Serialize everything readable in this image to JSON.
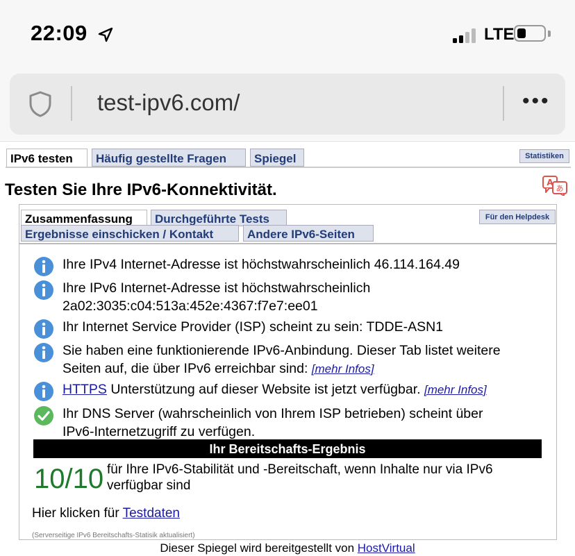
{
  "status_bar": {
    "time": "22:09",
    "network": "LTE"
  },
  "url_bar": {
    "url": "test-ipv6.com/",
    "menu": "•••"
  },
  "top_tabs": {
    "test": "IPv6 testen",
    "faq": "Häufig gestellte Fragen",
    "mirror": "Spiegel",
    "stats": "Statistiken"
  },
  "page_title": "Testen Sie Ihre IPv6-Konnektivität.",
  "inner_tabs": {
    "summary": "Zusammenfassung",
    "tests": "Durchgeführte Tests",
    "helpdesk": "Für den Helpdesk",
    "submit": "Ergebnisse einschicken / Kontakt",
    "other": "Andere IPv6-Seiten"
  },
  "results": {
    "ipv4": "Ihre IPv4 Internet-Adresse ist höchstwahrscheinlich 46.114.164.49",
    "ipv6_line1": "Ihre IPv6 Internet-Adresse ist höchstwahrscheinlich",
    "ipv6_line2": "2a02:3035:c04:513a:452e:4367:f7e7:ee01",
    "isp": "Ihr Internet Service Provider (ISP) scheint zu sein: TDDE-ASN1",
    "ipv6_conn_line1": "Sie haben eine funktionierende IPv6-Anbindung. Dieser Tab listet weitere",
    "ipv6_conn_line2": "Seiten auf, die über IPv6 erreichbar sind:",
    "more_info": "[mehr Infos]",
    "https_link": "HTTPS",
    "https_text": " Unterstützung auf dieser Website ist jetzt verfügbar.",
    "more_info2": "[mehr Infos]",
    "dns_line1": "Ihr DNS Server (wahrscheinlich von Ihrem ISP betrieben) scheint über",
    "dns_line2": "IPv6-Internetzugriff zu verfügen."
  },
  "readiness": {
    "header": "Ihr Bereitschafts-Ergebnis",
    "score": "10/10",
    "text": "für Ihre IPv6-Stabilität und -Bereitschaft, wenn Inhalte nur via IPv6 verfügbar sind"
  },
  "click_text": "Hier klicken für ",
  "testdata_link": "Testdaten",
  "server_note": "(Serverseitige IPv6 Bereitschafts-Statisik aktualisiert)",
  "footer": {
    "text": "Dieser Spiegel wird bereitgestellt von ",
    "link": "HostVirtual"
  },
  "colors": {
    "tab_bg": "#dde2ec",
    "tab_text": "#223c7a",
    "info_blue": "#4a90d9",
    "ok_green": "#5cb85c",
    "score_green": "#1c7a2a",
    "link": "#1a1aa6"
  }
}
